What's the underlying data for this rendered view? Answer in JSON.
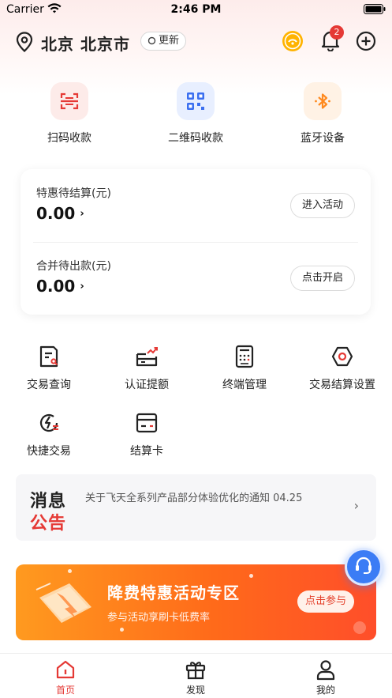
{
  "status_bar": {
    "carrier": "Carrier",
    "time": "2:46 PM"
  },
  "header": {
    "location": "北京 北京市",
    "update_label": "更新",
    "notification_count": "2"
  },
  "quick_actions": [
    {
      "label": "扫码收款",
      "icon": "scan-code-icon"
    },
    {
      "label": "二维码收款",
      "icon": "qr-code-icon"
    },
    {
      "label": "蓝牙设备",
      "icon": "bluetooth-icon"
    }
  ],
  "settlement_card": {
    "rows": [
      {
        "label": "特惠待结算(元)",
        "value": "0.00",
        "button": "进入活动"
      },
      {
        "label": "合并待出款(元)",
        "value": "0.00",
        "button": "点击开启"
      }
    ]
  },
  "menu_grid": [
    {
      "label": "交易查询",
      "icon": "transaction-query-icon"
    },
    {
      "label": "认证提额",
      "icon": "credit-raise-icon"
    },
    {
      "label": "终端管理",
      "icon": "terminal-icon"
    },
    {
      "label": "交易结算设置",
      "icon": "settlement-settings-icon"
    },
    {
      "label": "快捷交易",
      "icon": "quick-trade-icon"
    },
    {
      "label": "结算卡",
      "icon": "bank-card-icon"
    }
  ],
  "notice": {
    "tag_line1": "消息",
    "tag_line2": "公告",
    "message": "关于飞天全系列产品部分体验优化的通知  04.25"
  },
  "promo": {
    "title": "降费特惠活动专区",
    "subtitle": "参与活动享刷卡低费率",
    "button": "点击参与"
  },
  "tabbar": [
    {
      "label": "首页",
      "icon": "home-icon",
      "active": true
    },
    {
      "label": "发现",
      "icon": "gift-icon",
      "active": false
    },
    {
      "label": "我的",
      "icon": "user-icon",
      "active": false
    }
  ],
  "colors": {
    "accent": "#e53935",
    "promo_orange": "#ff6a1a",
    "service_blue": "#3b7cf5"
  }
}
